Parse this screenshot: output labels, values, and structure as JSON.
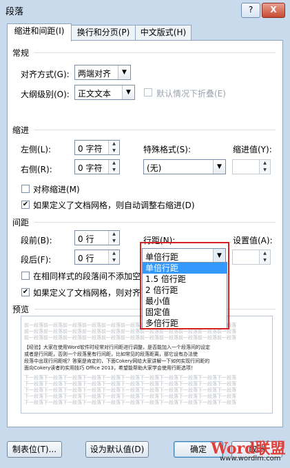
{
  "window": {
    "title": "段落",
    "help": "?",
    "close": "X"
  },
  "tabs": [
    "缩进和间距(I)",
    "换行和分页(P)",
    "中文版式(H)"
  ],
  "general": {
    "heading": "常规",
    "align_label": "对齐方式(G):",
    "align_value": "两端对齐",
    "outline_label": "大纲级别(O):",
    "outline_value": "正文文本",
    "collapse_label": "默认情况下折叠(E)"
  },
  "indent": {
    "heading": "缩进",
    "left_label": "左侧(L):",
    "left_value": "0 字符",
    "right_label": "右侧(R):",
    "right_value": "0 字符",
    "special_label": "特殊格式(S):",
    "special_value": "(无)",
    "by_label": "缩进值(Y):",
    "mirror_label": "对称缩进(M)",
    "auto_adjust_label": "如果定义了文档网格，则自动调整右缩进(D)"
  },
  "spacing": {
    "heading": "间距",
    "before_label": "段前(B):",
    "before_value": "0 行",
    "after_label": "段后(F):",
    "after_value": "0 行",
    "line_label": "行距(N):",
    "line_value": "单倍行距",
    "at_label": "设置值(A):",
    "no_space_label": "在相同样式的段落间不添加空",
    "snap_label": "如果定义了文档网格，则对齐",
    "options": [
      "单倍行距",
      "1.5 倍行距",
      "2 倍行距",
      "最小值",
      "固定值",
      "多倍行距"
    ]
  },
  "preview": {
    "heading": "预览",
    "filler": "前一段落前一段落前一段落前一段落前一段落前一段落前一段落前一段落前一段落前一段落前一段落",
    "sample_lines": [
      "【经验】大家在使用Word软件时经常对行间距进行调整，是否能加入一个段落间的设定",
      "或者是行间距，否则一个段落里有行间距，比如常见的段落距离，那它设有办法使",
      "段落中出现行间距呢？答案是肯定的，下面Cokery网给大家讲解一下如何实现行间距的",
      "面向Cokery读者的实用技巧 Office 2013，希望能帮助大家学会使用行距选项！"
    ],
    "after_filler": "下一段落下一段落下一段落下一段落下一段落下一段落下一段落下一段落下一段落下一段落下一段落"
  },
  "buttons": {
    "tabs": "制表位(T)...",
    "default": "设为默认值(D)",
    "ok": "确定",
    "cancel": "取消"
  },
  "watermark": {
    "brand": "Word联盟",
    "url": "www.wordlm.com"
  }
}
